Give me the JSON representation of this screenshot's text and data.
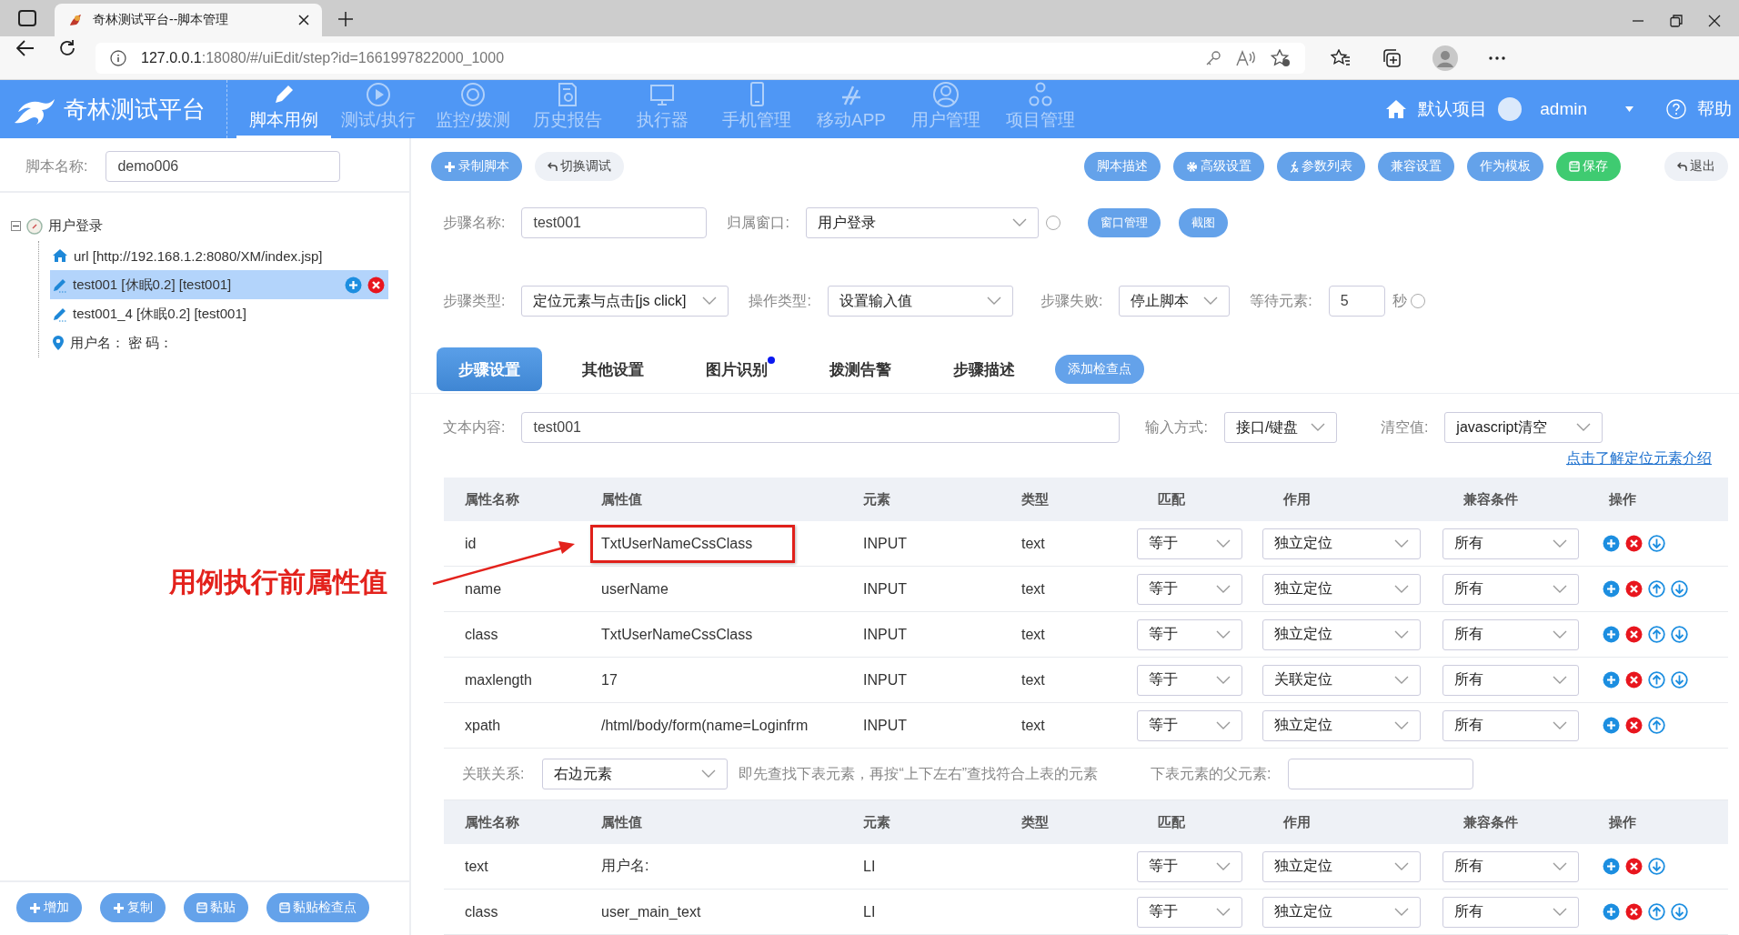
{
  "browser": {
    "tab_title": "奇林测试平台--脚本管理",
    "url_host": "127.0.0.1",
    "url_path": ":18080/#/uiEdit/step?id=1661997822000_1000"
  },
  "nav": {
    "logo": "奇林测试平台",
    "items": [
      {
        "label": "脚本用例",
        "kind": "pencil",
        "selected": true
      },
      {
        "label": "测试/执行",
        "kind": "play",
        "selected": false
      },
      {
        "label": "监控/拨测",
        "kind": "target",
        "selected": false
      },
      {
        "label": "历史报告",
        "kind": "report",
        "selected": false
      },
      {
        "label": "执行器",
        "kind": "monitor",
        "selected": false
      },
      {
        "label": "手机管理",
        "kind": "phone",
        "selected": false
      },
      {
        "label": "移动APP",
        "kind": "app",
        "selected": false
      },
      {
        "label": "用户管理",
        "kind": "user",
        "selected": false
      },
      {
        "label": "项目管理",
        "kind": "org",
        "selected": false
      }
    ],
    "project": "默认项目",
    "user": "admin",
    "help": "帮助"
  },
  "script": {
    "label": "脚本名称:",
    "value": "demo006"
  },
  "tree": [
    {
      "label": "用户登录",
      "kind": "window",
      "selected": false,
      "expanded": true,
      "children": [
        {
          "label": "url [http://192.168.1.2:8080/XM/index.jsp]",
          "kind": "url",
          "selected": false
        },
        {
          "label": "test001 [休眠0.2] [test001]",
          "kind": "step",
          "selected": true
        },
        {
          "label": "test001_4 [休眠0.2] [test001]",
          "kind": "step",
          "selected": false
        },
        {
          "label": "用户名： 密 码：",
          "kind": "location",
          "selected": false
        }
      ]
    }
  ],
  "left_buttons": [
    {
      "label": "增加"
    },
    {
      "label": "复制"
    },
    {
      "label": "黏贴"
    },
    {
      "label": "黏贴检查点"
    }
  ],
  "toolbar": {
    "left": [
      {
        "label": "录制脚本",
        "kind": "primary"
      },
      {
        "label": "切换调试",
        "kind": "light"
      }
    ],
    "right": [
      {
        "label": "脚本描述",
        "kind": "primary"
      },
      {
        "label": "高级设置",
        "kind": "primary"
      },
      {
        "label": "参数列表",
        "kind": "primary"
      },
      {
        "label": "兼容设置",
        "kind": "primary"
      },
      {
        "label": "作为模板",
        "kind": "primary"
      },
      {
        "label": "保存",
        "kind": "success"
      },
      {
        "label": "退出",
        "kind": "light"
      }
    ]
  },
  "step_form": {
    "name_label": "步骤名称:",
    "name_value": "test001",
    "window_label": "归属窗口:",
    "window_value": "用户登录",
    "window_buttons": [
      "窗口管理",
      "截图"
    ],
    "type_label": "步骤类型:",
    "type_value": "定位元素与点击[js click]",
    "op_label": "操作类型:",
    "op_value": "设置输入值",
    "fail_label": "步骤失败:",
    "fail_value": "停止脚本",
    "wait_label": "等待元素:",
    "wait_value": "5",
    "wait_unit": "秒"
  },
  "tabs": [
    {
      "label": "步骤设置",
      "selected": true,
      "dot": false
    },
    {
      "label": "其他设置",
      "selected": false,
      "dot": false
    },
    {
      "label": "图片识别",
      "selected": false,
      "dot": true
    },
    {
      "label": "拨测告警",
      "selected": false,
      "dot": false
    },
    {
      "label": "步骤描述",
      "selected": false,
      "dot": false
    }
  ],
  "add_checkpoint": "添加检查点",
  "input_form": {
    "text_label": "文本内容:",
    "text_value": "test001",
    "method_label": "输入方式:",
    "method_value": "接口/键盘",
    "clear_label": "清空值:",
    "clear_value": "javascript清空",
    "help_link": "点击了解定位元素介绍"
  },
  "table1_columns": [
    "属性名称",
    "属性值",
    "元素",
    "类型",
    "匹配",
    "作用",
    "兼容条件",
    "操作"
  ],
  "table1": [
    {
      "name": "id",
      "value": "TxtUserNameCssClass",
      "element": "INPUT",
      "type": "text",
      "match": "等于",
      "role": "独立定位",
      "compat": "所有",
      "highlighted": true,
      "up": false,
      "down": true
    },
    {
      "name": "name",
      "value": "userName",
      "element": "INPUT",
      "type": "text",
      "match": "等于",
      "role": "独立定位",
      "compat": "所有",
      "highlighted": false,
      "up": true,
      "down": true
    },
    {
      "name": "class",
      "value": "TxtUserNameCssClass",
      "element": "INPUT",
      "type": "text",
      "match": "等于",
      "role": "独立定位",
      "compat": "所有",
      "highlighted": false,
      "up": true,
      "down": true
    },
    {
      "name": "maxlength",
      "value": "17",
      "element": "INPUT",
      "type": "text",
      "match": "等于",
      "role": "关联定位",
      "compat": "所有",
      "highlighted": false,
      "up": true,
      "down": true
    },
    {
      "name": "xpath",
      "value": "/html/body/form(name=Loginfrm",
      "element": "INPUT",
      "type": "text",
      "match": "等于",
      "role": "独立定位",
      "compat": "所有",
      "highlighted": false,
      "up": true,
      "down": false
    }
  ],
  "relation": {
    "label": "关联关系:",
    "value": "右边元素",
    "hint": "即先查找下表元素，再按“上下左右”查找符合上表的元素",
    "parent_label": "下表元素的父元素:"
  },
  "table2_columns": [
    "属性名称",
    "属性值",
    "元素",
    "类型",
    "匹配",
    "作用",
    "兼容条件",
    "操作"
  ],
  "table2": [
    {
      "name": "text",
      "value": "用户名:",
      "element": "LI",
      "match": "等于",
      "role": "独立定位",
      "compat": "所有",
      "highlighted": false,
      "up": false,
      "down": true
    },
    {
      "name": "class",
      "value": "user_main_text",
      "element": "LI",
      "match": "等于",
      "role": "独立定位",
      "compat": "所有",
      "highlighted": false,
      "up": true,
      "down": true
    }
  ],
  "annotation": {
    "text": "用例执行前属性值"
  }
}
